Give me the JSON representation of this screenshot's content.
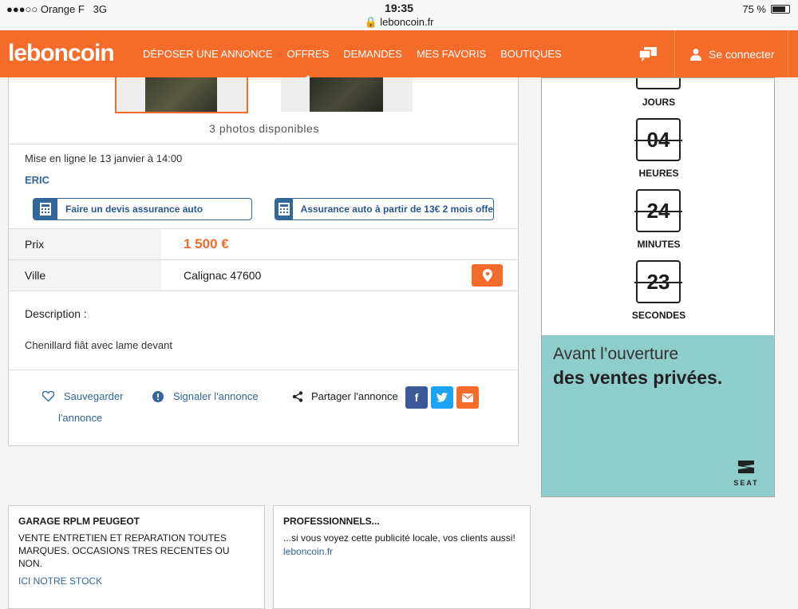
{
  "status_bar": {
    "carrier": "●●●○○ Orange F",
    "network": "3G",
    "time": "19:35",
    "url": "leboncoin.fr",
    "battery": "75 %"
  },
  "nav": {
    "logo": "leboncoin",
    "links": [
      "DÉPOSER UNE ANNONCE",
      "OFFRES",
      "DEMANDES",
      "MES FAVORIS",
      "BOUTIQUES"
    ],
    "active_link": "OFFRES",
    "login_label": "Se connecter"
  },
  "listing": {
    "photos_count_label": "3 photos disponibles",
    "posted_label": "Mise en ligne le 13 janvier à 14:00",
    "author": "ERIC",
    "insurance_quote_label": "Faire un devis assurance auto",
    "insurance_offer_label": "Assurance auto à partir de 13€ 2 mois offe",
    "price_label": "Prix",
    "price_value": "1 500 €",
    "city_label": "Ville",
    "city_value": "Calignac 47600",
    "description_title": "Description :",
    "description_text": "Chenillard fiât avec lame devant",
    "save_label_line1": "Sauvegarder",
    "save_label_line2": "l'annonce",
    "report_label": "Signaler l'annonce",
    "share_label": "Partager l'annonce"
  },
  "ad": {
    "countdown": [
      {
        "value": "",
        "label": "JOURS"
      },
      {
        "value": "04",
        "label": "HEURES"
      },
      {
        "value": "24",
        "label": "MINUTES"
      },
      {
        "value": "23",
        "label": "SECONDES"
      }
    ],
    "headline_line1": "Avant l’ouverture",
    "headline_line2": "des ventes privées.",
    "brand": "SEAT"
  },
  "cards": [
    {
      "title": "GARAGE RPLM PEUGEOT",
      "body": "VENTE ENTRETIEN ET REPARATION TOUTES MARQUES. OCCASIONS TRES RECENTES OU NON.",
      "link": "ICI NOTRE STOCK"
    },
    {
      "title": "PROFESSIONNELS...",
      "body": "...si vous voyez cette publicité locale, vos clients aussi!",
      "link": "leboncoin.fr"
    }
  ],
  "colors": {
    "brand_orange": "#f56b2a",
    "link_blue": "#336699",
    "ad_teal": "#8fcccc"
  }
}
